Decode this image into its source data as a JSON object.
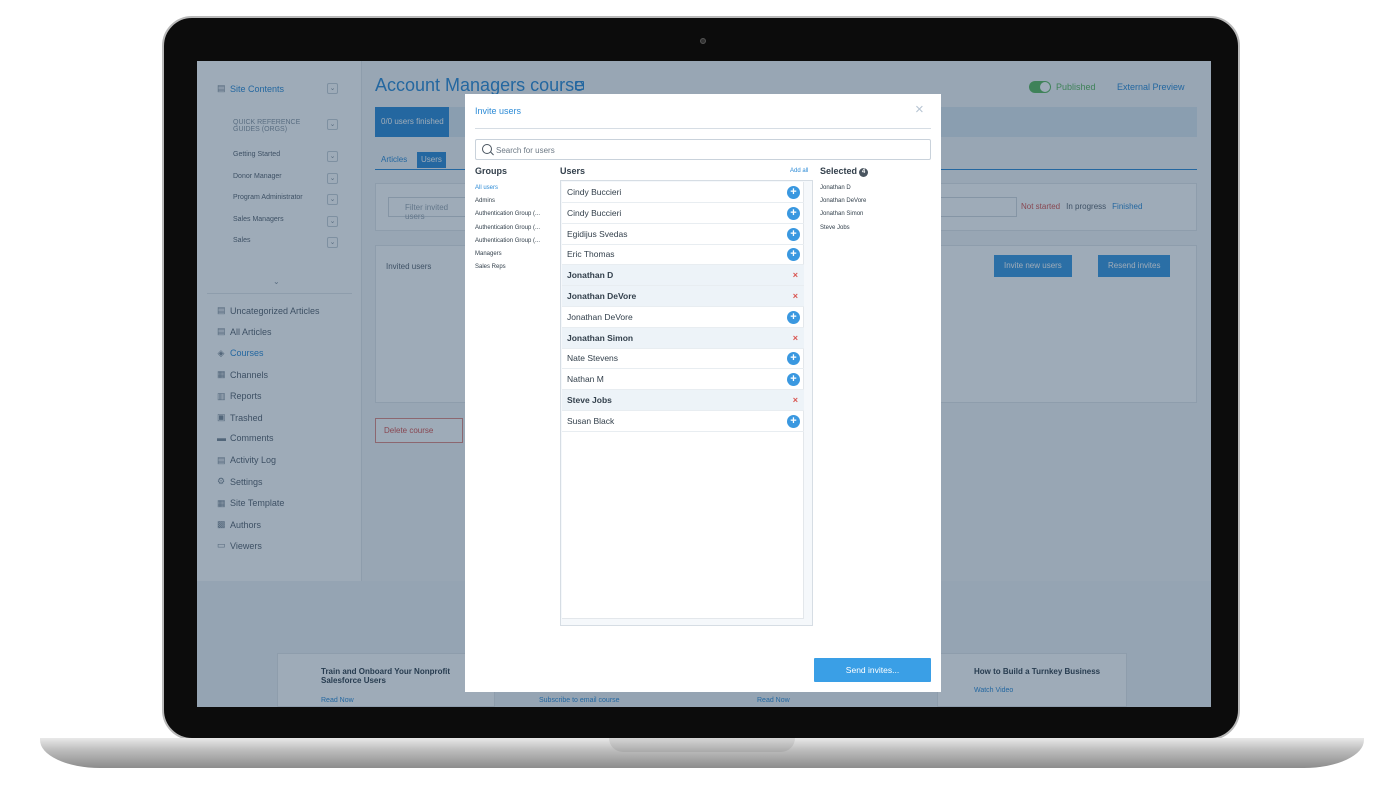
{
  "app": {
    "sidebar": {
      "site_contents": "Site Contents",
      "sub_items": [
        "QUICK REFERENCE GUIDES (ORGS)",
        "Getting Started",
        "Donor Manager",
        "Program Administrator",
        "Sales Managers",
        "Sales"
      ],
      "nav_items": [
        "Uncategorized Articles",
        "All Articles",
        "Courses",
        "Channels",
        "Reports",
        "Trashed",
        "Comments",
        "Activity Log",
        "Settings",
        "Site Template",
        "Authors",
        "Viewers"
      ]
    },
    "page_title": "Account Managers course",
    "published_label": "Published",
    "external_preview": "External Preview",
    "progress_text": "0/0 users finished",
    "progress_fraction": 0.09,
    "tabs": [
      "Articles",
      "Users"
    ],
    "filter_placeholder": "Filter invited users",
    "status_legend": [
      "Not started",
      "In progress",
      "Finished"
    ],
    "invited_users_label": "Invited users",
    "invite_new_users": "Invite new users",
    "resend_invites": "Resend invites",
    "delete_course": "Delete course",
    "footer": {
      "card1_title": "Train and Onboard Your Nonprofit Salesforce Users",
      "card1_link": "Read Now",
      "card2_link": "Subscribe to email course",
      "card3_link": "Read Now",
      "card4_title": "How to Build a Turnkey Business",
      "card4_link": "Watch Video"
    }
  },
  "modal": {
    "title": "Invite users",
    "search_placeholder": "Search for users",
    "groups_heading": "Groups",
    "users_heading": "Users",
    "add_all": "Add all",
    "selected_heading": "Selected",
    "selected_count": "4",
    "groups": [
      "All users",
      "Admins",
      "Authentication Group (...",
      "Authentication Group (...",
      "Authentication Group (...",
      "Managers",
      "Sales Reps"
    ],
    "users": [
      {
        "name": "Cindy Buccieri",
        "selected": false
      },
      {
        "name": "Cindy Buccieri",
        "selected": false
      },
      {
        "name": "Egidijus Svedas",
        "selected": false
      },
      {
        "name": "Eric Thomas",
        "selected": false
      },
      {
        "name": "Jonathan D",
        "selected": true
      },
      {
        "name": "Jonathan DeVore",
        "selected": true
      },
      {
        "name": "Jonathan DeVore",
        "selected": false
      },
      {
        "name": "Jonathan Simon",
        "selected": true
      },
      {
        "name": "Nate Stevens",
        "selected": false
      },
      {
        "name": "Nathan M",
        "selected": false
      },
      {
        "name": "Steve Jobs",
        "selected": true
      },
      {
        "name": "Susan Black",
        "selected": false
      }
    ],
    "selected_users": [
      "Jonathan D",
      "Jonathan DeVore",
      "Jonathan Simon",
      "Steve Jobs"
    ],
    "send_button": "Send invites..."
  },
  "icons": {
    "add": "+",
    "remove": "×",
    "close": "×"
  }
}
